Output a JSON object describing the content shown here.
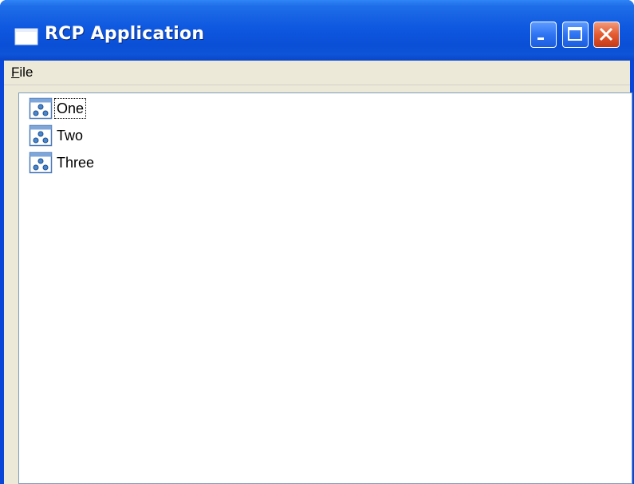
{
  "window": {
    "title": "RCP Application"
  },
  "menubar": {
    "file_prefix": "",
    "file_mnemonic": "F",
    "file_rest": "ile"
  },
  "tree": {
    "items": [
      {
        "label": "One",
        "icon": "view-icon",
        "focused": true
      },
      {
        "label": "Two",
        "icon": "view-icon",
        "focused": false
      },
      {
        "label": "Three",
        "icon": "view-icon",
        "focused": false
      }
    ]
  },
  "colors": {
    "titlebar_blue": "#0a4fd6",
    "close_red": "#e45a2f",
    "face": "#ece9d8",
    "tree_border": "#7f9db9"
  }
}
